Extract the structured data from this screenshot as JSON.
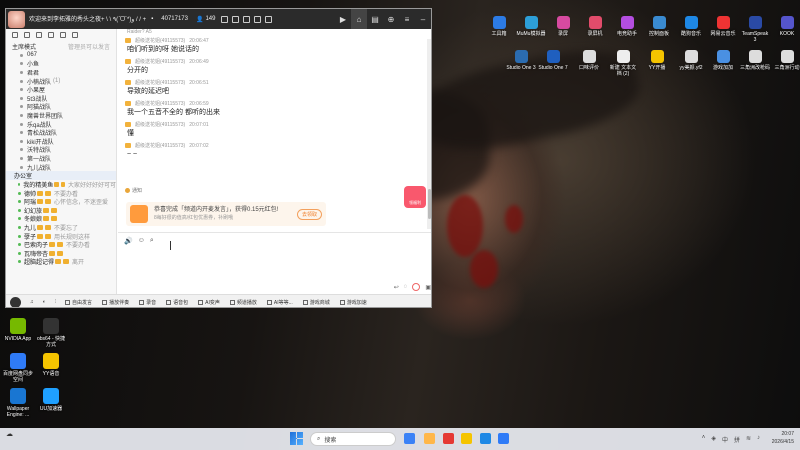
{
  "window": {
    "channel_name": "欢迎来到李拓雅的秀头之夜+ \\ \\ ٩(ˊᗜˋ*)و / / +",
    "channel_id": "40717173",
    "online_count": "149"
  },
  "sidebar": {
    "mode": "主席模式",
    "hint": "管理员可以发言",
    "channels": [
      {
        "name": "067",
        "count": ""
      },
      {
        "name": "小鱼",
        "count": ""
      },
      {
        "name": "君君",
        "count": ""
      },
      {
        "name": "小楠战队",
        "count": "(1)"
      },
      {
        "name": "小果屋",
        "count": ""
      },
      {
        "name": "5t3战队",
        "count": ""
      },
      {
        "name": "阿猫战队",
        "count": ""
      },
      {
        "name": "魔兽世界团队",
        "count": ""
      },
      {
        "name": "乐qa战队",
        "count": ""
      },
      {
        "name": "青松战战队",
        "count": ""
      },
      {
        "name": "kiki开战队",
        "count": ""
      },
      {
        "name": "沃特战队",
        "count": ""
      },
      {
        "name": "第一战队",
        "count": ""
      },
      {
        "name": "九儿战队",
        "count": ""
      }
    ],
    "group": "办公室",
    "members": [
      {
        "name": "我的精美鱼",
        "note": "大家好好好好可可"
      },
      {
        "name": "德帅",
        "note": "不要办看"
      },
      {
        "name": "阿瑞",
        "note": "心怀信念，不迷歪爱"
      },
      {
        "name": "幻幻旅",
        "note": ""
      },
      {
        "name": "冬娘娘",
        "note": ""
      },
      {
        "name": "九儿",
        "note": "不要忘了"
      },
      {
        "name": "孽子",
        "note": "用长规则这样"
      },
      {
        "name": "巴索肉子",
        "note": "不要办看"
      },
      {
        "name": "瓦嗨帝杏",
        "note": ""
      },
      {
        "name": "超脑超记得",
        "note": "离开"
      }
    ]
  },
  "chat": {
    "partial_top": "Raider? A5",
    "messages": [
      {
        "sender": "超级送花姐(49115573)",
        "time": "20:06:47",
        "text": "咱们听到的呀 她说话的"
      },
      {
        "sender": "超级送花姐(49115573)",
        "time": "20:06:49",
        "text": "分开的"
      },
      {
        "sender": "超级送花姐(49115573)",
        "time": "20:06:51",
        "text": "导致的延迟吧"
      },
      {
        "sender": "超级送花姐(49115573)",
        "time": "20:06:59",
        "text": "我一个五音不全的 都听的出来"
      },
      {
        "sender": "超级送花姐(49115573)",
        "time": "20:07:01",
        "text": "懂"
      },
      {
        "sender": "超级送花姐(49115573)",
        "time": "20:07:02",
        "text": "~ ~"
      }
    ],
    "notice_label": "通知",
    "promo_text": "恭喜完成「频道内开麦发言」，获得0.15元红包!",
    "promo_sub": "8每好很的值高/红包优惠券，补刷哦",
    "promo_button": "去领取",
    "gift_label": "领福利"
  },
  "bottombar": {
    "items": [
      "自由发言",
      "播放伴奏",
      "录音",
      "语音包",
      "AI变声",
      "频道播放",
      "AI等等...",
      "游戏商城",
      "游戏加速"
    ]
  },
  "desktop": {
    "icons": [
      {
        "label": "工具箱",
        "color": "#2c7be5"
      },
      {
        "label": "MuMu模拟器",
        "color": "#2d9fd8"
      },
      {
        "label": "录屏",
        "color": "#d74aa0"
      },
      {
        "label": "录屏机",
        "color": "#e24c6b"
      },
      {
        "label": "电竞助手",
        "color": "#b44ee0"
      },
      {
        "label": "控制面板",
        "color": "#3a8bd1"
      },
      {
        "label": "酷狗音乐",
        "color": "#1e88e5"
      },
      {
        "label": "网易云音乐",
        "color": "#e33"
      },
      {
        "label": "TeamSpeak 3",
        "color": "#2a4aa5"
      },
      {
        "label": "KOOK",
        "color": "#55c"
      },
      {
        "label": "Studio One 3",
        "color": "#2b6cb0"
      },
      {
        "label": "Studio One 7",
        "color": "#1f5fbf"
      },
      {
        "label": "口味评价",
        "color": "#ddd"
      },
      {
        "label": "新建 文本文档 (2)",
        "color": "#eee"
      },
      {
        "label": "YY开播",
        "color": "#f5c400"
      },
      {
        "label": "yy美颜.yf2",
        "color": "#ddd"
      },
      {
        "label": "游戏加加",
        "color": "#4a90e2"
      },
      {
        "label": "三角洲改枪码",
        "color": "#ddd"
      },
      {
        "label": "三角洲行动",
        "color": "#ddd"
      },
      {
        "label": "NVIDIA App",
        "color": "#76b900"
      },
      {
        "label": "obs64 - 快捷方式",
        "color": "#333"
      },
      {
        "label": "百度网盘同步空间",
        "color": "#2f7bf7"
      },
      {
        "label": "YY语音",
        "color": "#f5c400"
      },
      {
        "label": "Wallpaper Engine: ...",
        "color": "#1976d2"
      },
      {
        "label": "UU加速器",
        "color": "#1fa0ff"
      }
    ]
  },
  "taskbar": {
    "search_placeholder": "搜索",
    "lang1": "中",
    "lang2": "拼",
    "time": "20:07",
    "date": "2026/4/15"
  }
}
